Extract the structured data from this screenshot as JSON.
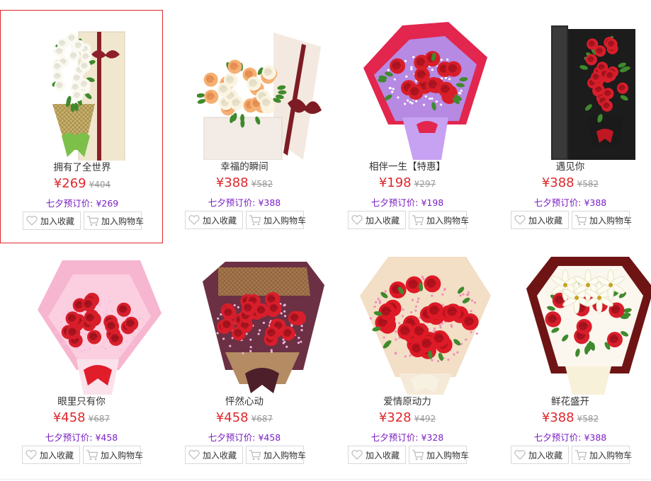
{
  "labels": {
    "fav": "加入收藏",
    "cart": "加入购物车",
    "presale_prefix": "七夕预订价:"
  },
  "products": [
    {
      "name": "拥有了全世界",
      "price": "¥269",
      "old_price": "¥404",
      "presale": "¥269",
      "highlight": true,
      "art": "box-white"
    },
    {
      "name": "幸福的瞬间",
      "price": "¥388",
      "old_price": "¥582",
      "presale": "¥388",
      "art": "box-open"
    },
    {
      "name": "相伴一生【特惠】",
      "price": "¥198",
      "old_price": "¥297",
      "presale": "¥198",
      "art": "bouquet-purple"
    },
    {
      "name": "遇见你",
      "price": "¥388",
      "old_price": "¥582",
      "presale": "¥388",
      "art": "box-black"
    },
    {
      "name": "眼里只有你",
      "price": "¥458",
      "old_price": "¥687",
      "presale": "¥458",
      "art": "bouquet-pink"
    },
    {
      "name": "怦然心动",
      "price": "¥458",
      "old_price": "¥687",
      "presale": "¥458",
      "art": "bouquet-brown"
    },
    {
      "name": "爱情原动力",
      "price": "¥328",
      "old_price": "¥492",
      "presale": "¥328",
      "art": "bouquet-round"
    },
    {
      "name": "鲜花盛开",
      "price": "¥388",
      "old_price": "¥582",
      "presale": "¥388",
      "art": "bouquet-lily"
    }
  ],
  "colors": {
    "accent_red": "#e0272b",
    "presale_purple": "#7a1fc4",
    "muted_gray": "#999999"
  }
}
